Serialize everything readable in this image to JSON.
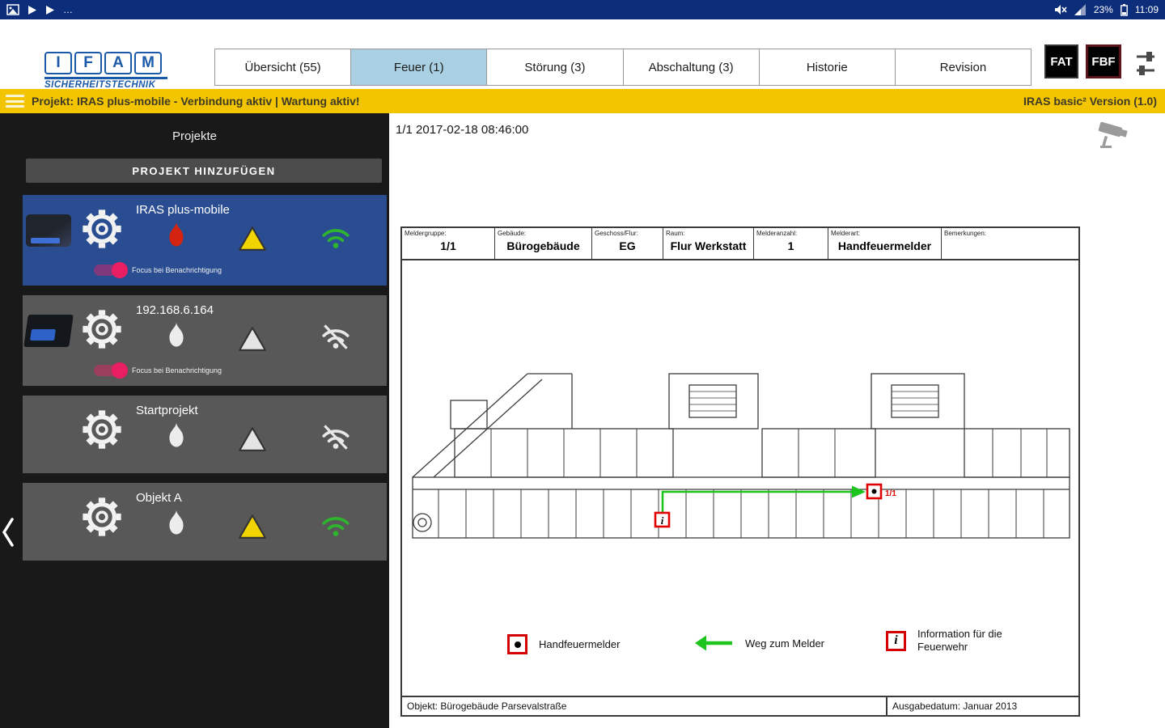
{
  "colors": {
    "status_bar_navy": "#0c2e7a",
    "selected_project_blue": "#2a4d92",
    "project_bar_yellow": "#f2c500",
    "active_tab_blue": "#a9cfe2",
    "toggle_pink": "#e91e63",
    "wifi_ok_green": "#2db52d",
    "alarm_red": "#d42310",
    "legend_red": "#d40000",
    "route_green": "#1ec41e",
    "warning_yellow": "#f2d500",
    "logo_blue": "#1a5aa8"
  },
  "status_bar": {
    "time": "11:09",
    "battery_percent": "23%",
    "overflow_dots": "…"
  },
  "header": {
    "logo_letters": [
      "I",
      "F",
      "A",
      "M"
    ],
    "logo_subtitle": "SICHERHEITSTECHNIK",
    "tabs": [
      {
        "label": "Übersicht (55)",
        "active": false
      },
      {
        "label": "Feuer (1)",
        "active": true
      },
      {
        "label": "Störung (3)",
        "active": false
      },
      {
        "label": "Abschaltung (3)",
        "active": false
      },
      {
        "label": "Historie",
        "active": false
      },
      {
        "label": "Revision",
        "active": false
      }
    ],
    "fat_label": "FAT",
    "fbf_label": "FBF"
  },
  "project_bar": {
    "status_text": "Projekt:  IRAS plus-mobile  -  Verbindung aktiv | Wartung aktiv!",
    "version_text": "IRAS basic² Version (1.0)"
  },
  "sidebar": {
    "title": "Projekte",
    "add_button_label": "PROJEKT HINZUFÜGEN",
    "focus_toggle_label": "Focus bei Benachrichtigung",
    "projects": [
      {
        "name": "IRAS plus-mobile",
        "selected": true,
        "fire": "red",
        "warning": "yellow",
        "wifi": "connected",
        "focus_toggle": true
      },
      {
        "name": "192.168.6.164",
        "selected": false,
        "fire": "white",
        "warning": "white",
        "wifi": "disconnected",
        "focus_toggle": true
      },
      {
        "name": "Startprojekt",
        "selected": false,
        "fire": "white",
        "warning": "white",
        "wifi": "disconnected",
        "focus_toggle": false
      },
      {
        "name": "Objekt A",
        "selected": false,
        "fire": "white",
        "warning": "yellow",
        "wifi": "connected",
        "focus_toggle": false
      }
    ]
  },
  "main": {
    "timestamp": "1/1 2017-02-18 08:46:00",
    "laufkarte": {
      "header_cells": [
        {
          "label": "Meldergruppe:",
          "value": "1/1"
        },
        {
          "label": "Gebäude:",
          "value": "Bürogebäude"
        },
        {
          "label": "Geschoss/Flur:",
          "value": "EG"
        },
        {
          "label": "Raum:",
          "value": "Flur Werkstatt"
        },
        {
          "label": "Melderanzahl:",
          "value": "1"
        },
        {
          "label": "Melderart:",
          "value": "Handfeuermelder"
        },
        {
          "label": "Bemerkungen:",
          "value": ""
        }
      ],
      "marker_label": "1/1",
      "legend": [
        {
          "label": "Handfeuermelder"
        },
        {
          "label": "Weg zum Melder"
        },
        {
          "label": "Information für die Feuerwehr"
        }
      ],
      "footer_left": "Objekt: Bürogebäude Parsevalstraße",
      "footer_right": "Ausgabedatum: Januar 2013"
    }
  }
}
